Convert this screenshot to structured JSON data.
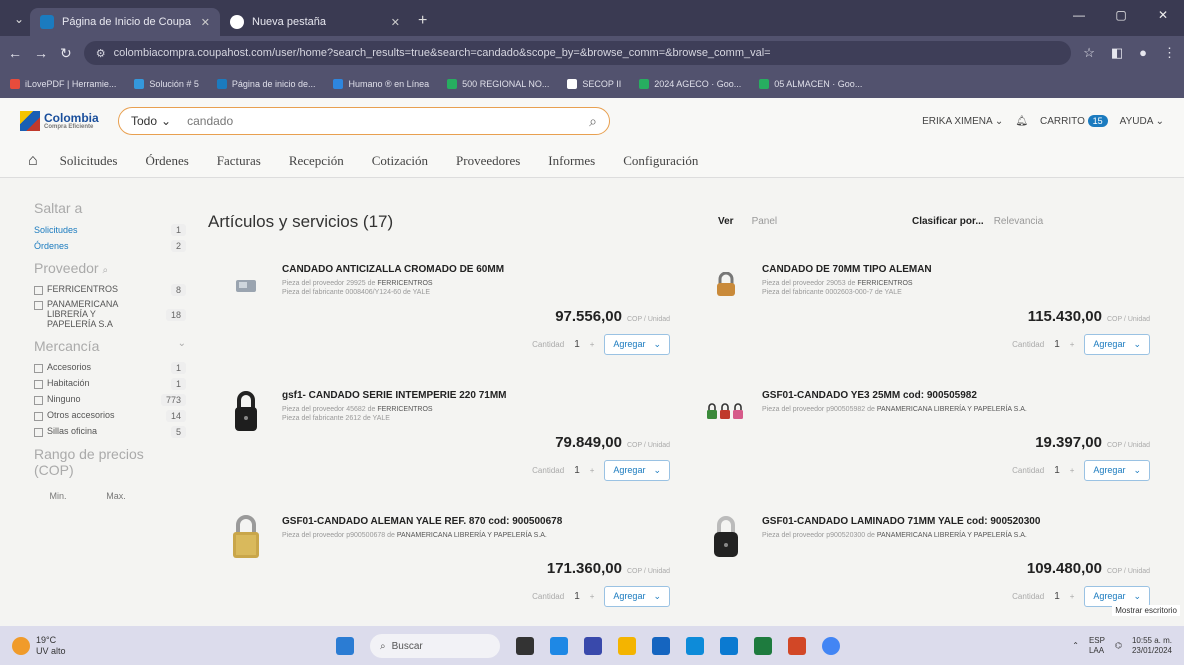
{
  "browser": {
    "tabs": [
      {
        "label": "Página de Inicio de Coupa",
        "active": true
      },
      {
        "label": "Nueva pestaña",
        "active": false
      }
    ],
    "new_tab": "+",
    "url": "colombiacompra.coupahost.com/user/home?search_results=true&search=candado&scope_by=&browse_comm=&browse_comm_val=",
    "bookmarks": [
      "iLovePDF | Herramie...",
      "Solución # 5",
      "Página de inicio de...",
      "Humano ® en Línea",
      "500 REGIONAL NO...",
      "SECOP II",
      "2024 AGECO · Goo...",
      "05 ALMACEN · Goo..."
    ],
    "win_controls": [
      "—",
      "▢",
      "✕"
    ]
  },
  "header": {
    "logo_text": "Colombia",
    "logo_sub": "Compra Eficiente",
    "scope": "Todo",
    "search_value": "candado",
    "user": "ERIKA XIMENA",
    "cart_label": "CARRITO",
    "cart_count": "15",
    "help": "AYUDA"
  },
  "nav": [
    "Solicitudes",
    "Órdenes",
    "Facturas",
    "Recepción",
    "Cotización",
    "Proveedores",
    "Informes",
    "Configuración"
  ],
  "sidebar": {
    "jump_title": "Saltar a",
    "jump": [
      {
        "label": "Solicitudes",
        "count": "1"
      },
      {
        "label": "Órdenes",
        "count": "2"
      }
    ],
    "supplier_title": "Proveedor",
    "suppliers": [
      {
        "label": "FERRICENTROS",
        "count": "8"
      },
      {
        "label": "PANAMERICANA LIBRERÍA Y PAPELERÍA S.A",
        "count": "18"
      }
    ],
    "merch_title": "Mercancía",
    "merch": [
      {
        "label": "Accesorios",
        "count": "1"
      },
      {
        "label": "Habitación",
        "count": "1"
      },
      {
        "label": "Ninguno",
        "count": "773"
      },
      {
        "label": "Otros accesorios",
        "count": "14"
      },
      {
        "label": "Sillas oficina",
        "count": "5"
      }
    ],
    "price_title": "Rango de precios (COP)",
    "min": "Min.",
    "max": "Max."
  },
  "main": {
    "title": "Artículos y servicios (17)",
    "ver_label": "Ver",
    "ver_value": "Panel",
    "sort_label": "Clasificar por...",
    "sort_value": "Relevancia",
    "qty_label": "Cantidad",
    "qty_value": "1",
    "add_label": "Agregar",
    "unit": "COP / Unidad",
    "products": [
      {
        "name": "CANDADO ANTICIZALLA CROMADO DE 60MM",
        "meta1": "Pieza del proveedor 29925 de",
        "supplier": "FERRICENTROS",
        "meta2": "Pieza del fabricante 0008406/Y124-60 de YALE",
        "price": "97.556,00",
        "icon": "padlock-chrome-icon"
      },
      {
        "name": "CANDADO DE 70MM TIPO ALEMAN",
        "meta1": "Pieza del proveedor 29053 de",
        "supplier": "FERRICENTROS",
        "meta2": "Pieza del fabricante 0002603-000-7 de YALE",
        "price": "115.430,00",
        "icon": "padlock-brass-icon"
      },
      {
        "name": "gsf1- CANDADO SERIE INTEMPERIE 220 71MM",
        "meta1": "Pieza del proveedor 45682 de",
        "supplier": "FERRICENTROS",
        "meta2": "Pieza del fabricante 2612 de YALE",
        "price": "79.849,00",
        "icon": "padlock-black-icon"
      },
      {
        "name": "GSF01-CANDADO YE3 25MM cod: 900505982",
        "meta1": "Pieza del proveedor p900505982 de",
        "supplier": "PANAMERICANA LIBRERÍA Y PAPELERÍA S.A.",
        "meta2": "",
        "price": "19.397,00",
        "icon": "padlock-set-icon"
      },
      {
        "name": "GSF01-CANDADO ALEMAN YALE REF. 870 cod: 900500678",
        "meta1": "Pieza del proveedor p900500678 de",
        "supplier": "PANAMERICANA LIBRERÍA Y PAPELERÍA S.A.",
        "meta2": "",
        "price": "171.360,00",
        "icon": "padlock-gold-icon"
      },
      {
        "name": "GSF01-CANDADO LAMINADO 71MM YALE cod: 900520300",
        "meta1": "Pieza del proveedor p900520300 de",
        "supplier": "PANAMERICANA LIBRERÍA Y PAPELERÍA S.A.",
        "meta2": "",
        "price": "109.480,00",
        "icon": "padlock-laminated-icon"
      }
    ]
  },
  "taskbar": {
    "temp": "19°C",
    "weather": "UV alto",
    "search": "Buscar",
    "lang": "ESP",
    "lang2": "LAA",
    "time": "10:55 a. m.",
    "date": "23/01/2024",
    "show_desktop": "Mostrar escritorio"
  }
}
